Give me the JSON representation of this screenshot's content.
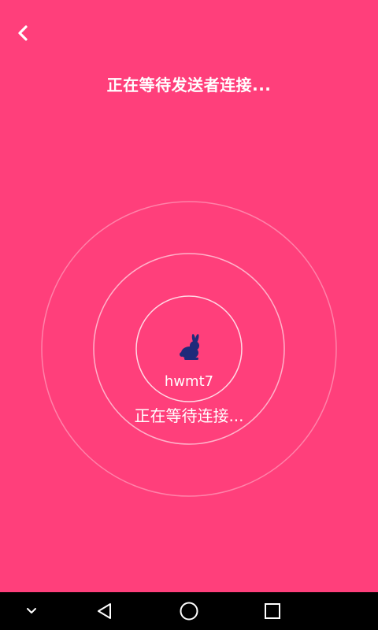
{
  "header": {
    "back_icon": "back-chevron-icon",
    "title": "正在等待发送者连接..."
  },
  "receiver": {
    "avatar_icon": "rabbit-icon",
    "avatar_color": "#1f2a7a",
    "name": "hwmt7",
    "status": "正在等待连接..."
  },
  "theme": {
    "background": "#ff3f7b",
    "ring_color": "#ffffff"
  },
  "navbar": {
    "items": [
      {
        "icon": "chevron-down-icon"
      },
      {
        "icon": "back-triangle-icon"
      },
      {
        "icon": "home-circle-icon"
      },
      {
        "icon": "recents-square-icon"
      }
    ]
  }
}
